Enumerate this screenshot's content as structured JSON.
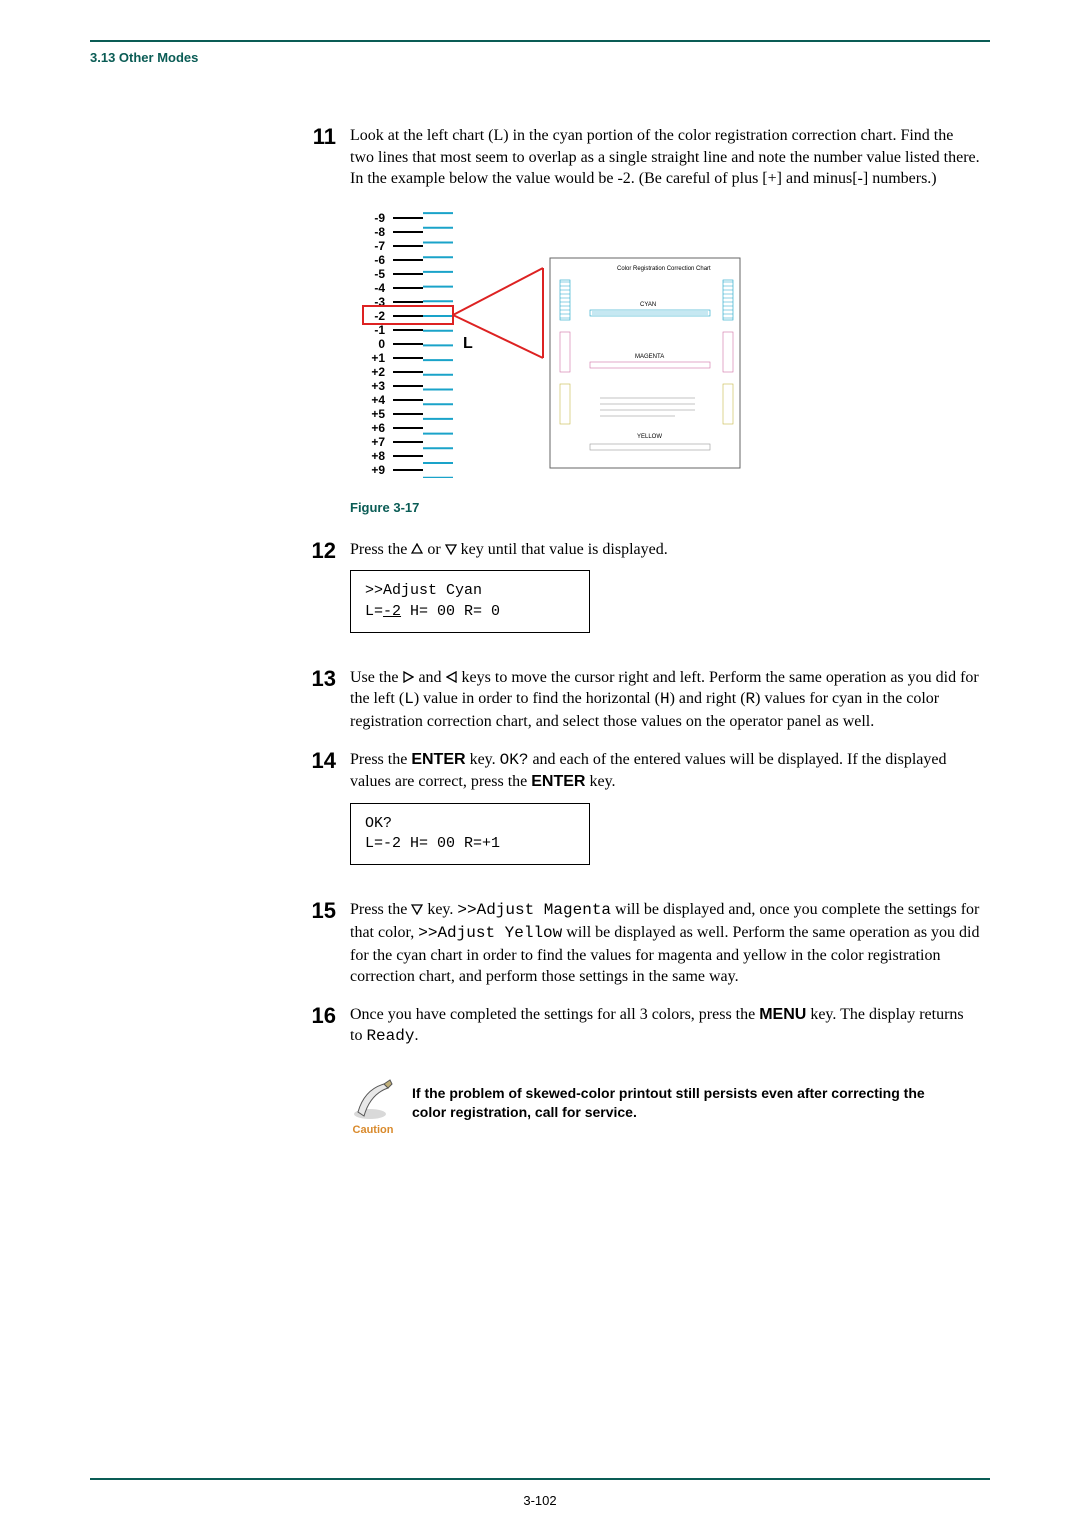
{
  "header": {
    "section": "3.13 Other Modes"
  },
  "steps": {
    "s11": {
      "num": "11",
      "text_a": "Look at the left chart (L) in the cyan portion of the color registration correction chart. Find the two lines that most seem to overlap as a single straight line and note the number value listed there. In the example below the value would be -2. (Be careful of plus [+] and minus[-] numbers.)"
    },
    "s12": {
      "num": "12",
      "text_a": "Press the ",
      "text_b": " or ",
      "text_c": " key until that value is displayed.",
      "panel": {
        "line1": ">>Adjust Cyan",
        "line2_pre": " L=",
        "line2_ul": "-2",
        "line2_post": " H= 00 R= 0"
      }
    },
    "s13": {
      "num": "13",
      "text_a": "Use the ",
      "text_b": " and ",
      "text_c": " keys to move the cursor right and left. Perform the same operation as you did for the left (",
      "code_L": "L",
      "text_d": ") value in order to find the horizontal (",
      "code_H": "H",
      "text_e": ") and right (",
      "code_R": "R",
      "text_f": ") values for cyan in the color registration correction chart, and select those values on the operator panel as well."
    },
    "s14": {
      "num": "14",
      "text_a": "Press the ",
      "key_enter": "ENTER",
      "text_b": " key. ",
      "code_ok": "OK?",
      "text_c": " and each of the entered values will be displayed. If the displayed values are correct, press the ",
      "text_d": " key.",
      "panel": {
        "line1": "OK?",
        "line2": " L=-2 H= 00 R=+1"
      }
    },
    "s15": {
      "num": "15",
      "text_a": "Press the ",
      "text_b": " key. ",
      "code_mag": ">>Adjust Magenta",
      "text_c": " will be displayed and, once you complete the settings for that color, ",
      "code_yel": ">>Adjust Yellow",
      "text_d": " will be displayed as well. Perform the same operation as you did for the cyan chart in order to find the values for magenta and yellow in the color registration correction chart, and perform those settings in the same way."
    },
    "s16": {
      "num": "16",
      "text_a": "Once you have completed the settings for all 3 colors, press the ",
      "key_menu": "MENU",
      "text_b": " key. The display returns to ",
      "code_ready": "Ready",
      "text_c": "."
    }
  },
  "figure": {
    "labels": [
      "-9",
      "-8",
      "-7",
      "-6",
      "-5",
      "-4",
      "-3",
      "-2",
      "-1",
      "0",
      "+1",
      "+2",
      "+3",
      "+4",
      "+5",
      "+6",
      "+7",
      "+8",
      "+9"
    ],
    "L": "L",
    "caption": "Figure 3-17",
    "mini_title": "Color Registration Correction Chart"
  },
  "caution": {
    "label": "Caution",
    "text": "If the problem of skewed-color printout still persists even after correcting the color registration, call for service."
  },
  "footer": {
    "page_num": "3-102"
  }
}
